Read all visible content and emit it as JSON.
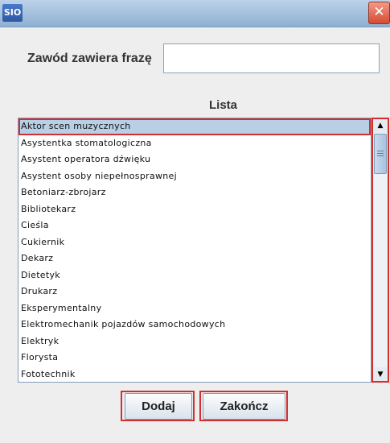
{
  "window": {
    "app_icon_text": "SIO",
    "title": "",
    "close_glyph": "✕"
  },
  "filter": {
    "label": "Zawód zawiera frazę",
    "value": "",
    "placeholder": ""
  },
  "list": {
    "title": "Lista",
    "selected_index": 0,
    "items": [
      "Aktor scen muzycznych",
      "Asystentka stomatologiczna",
      "Asystent operatora dźwięku",
      "Asystent osoby niepełnosprawnej",
      "Betoniarz-zbrojarz",
      "Bibliotekarz",
      "Cieśla",
      "Cukiernik",
      "Dekarz",
      "Dietetyk",
      "Drukarz",
      "Eksperymentalny",
      "Elektromechanik pojazdów samochodowych",
      "Elektryk",
      "Florysta",
      "Fototechnik"
    ]
  },
  "scrollbar": {
    "up_icon": "▲",
    "down_icon": "▼"
  },
  "buttons": {
    "add_label": "Dodaj",
    "finish_label": "Zakończ"
  },
  "colors": {
    "highlight": "#d03030",
    "selection": "#b8cfe5",
    "titlebar": "#9fbde0"
  }
}
